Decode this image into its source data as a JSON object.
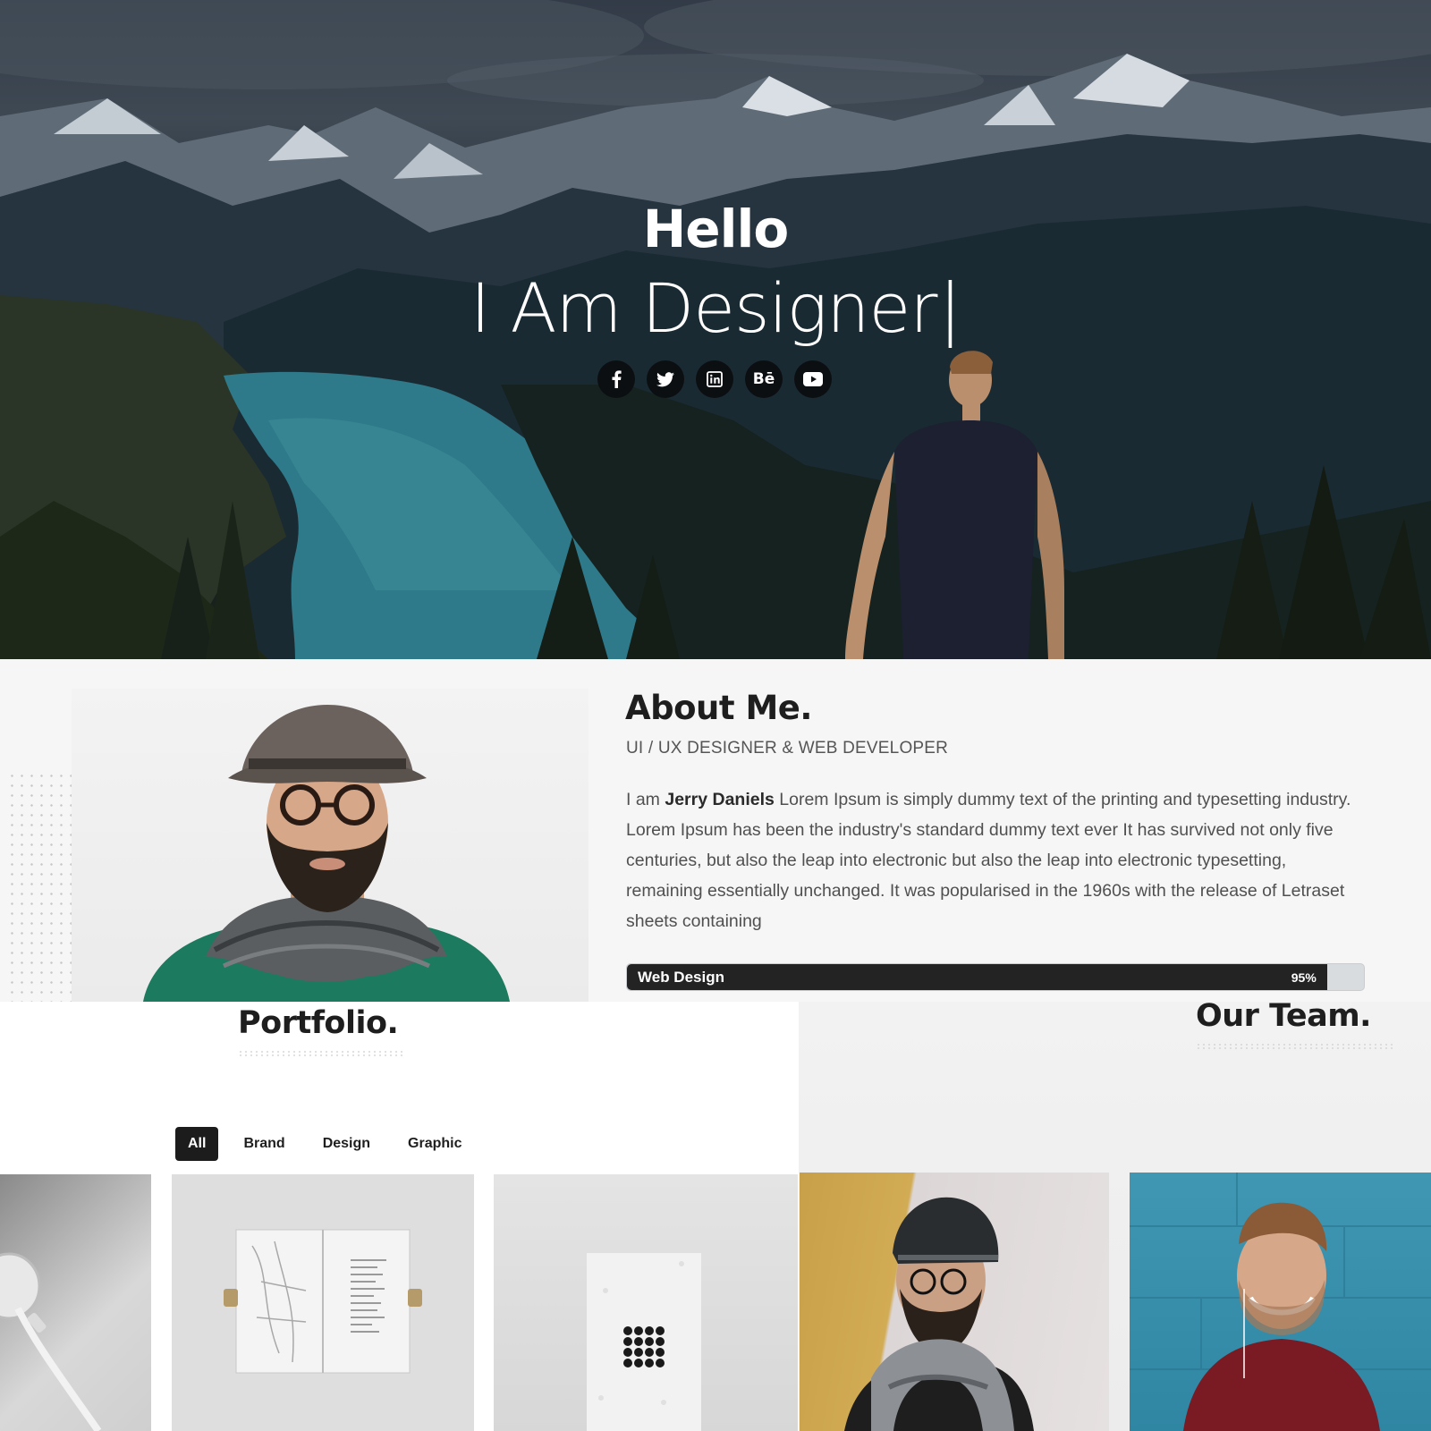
{
  "hero": {
    "title": "Hello",
    "subtitle": "I Am Designer",
    "caret": "|",
    "socials": [
      {
        "name": "facebook-icon",
        "glyph": "f"
      },
      {
        "name": "twitter-icon",
        "glyph": ""
      },
      {
        "name": "linkedin-icon",
        "glyph": "in"
      },
      {
        "name": "behance-icon",
        "glyph": "Bē"
      },
      {
        "name": "youtube-icon",
        "glyph": ""
      }
    ]
  },
  "about": {
    "title": "About Me.",
    "role": "UI / UX DESIGNER & WEB DEVELOPER",
    "intro": "I am",
    "name": "Jerry Daniels",
    "bio": "Lorem Ipsum is simply dummy text of the printing and typesetting industry. Lorem Ipsum has been the industry's standard dummy text ever It has survived not only five centuries, but also the leap into electronic but also the leap into electronic typesetting, remaining essentially unchanged. It was popularised in the 1960s with the release of Letraset sheets containing",
    "skills": [
      {
        "label": "Web Design",
        "value": "95%",
        "fraction": 0.95
      }
    ]
  },
  "portfolio": {
    "title": "Portfolio.",
    "filters": [
      "All",
      "Brand",
      "Design",
      "Graphic"
    ],
    "active_filter": "All"
  },
  "team": {
    "title": "Our Team."
  },
  "colors": {
    "dark": "#1c1c1c",
    "hero_overlay": "#14222c",
    "lake": "#2f7a8a",
    "text_muted": "#505050"
  }
}
